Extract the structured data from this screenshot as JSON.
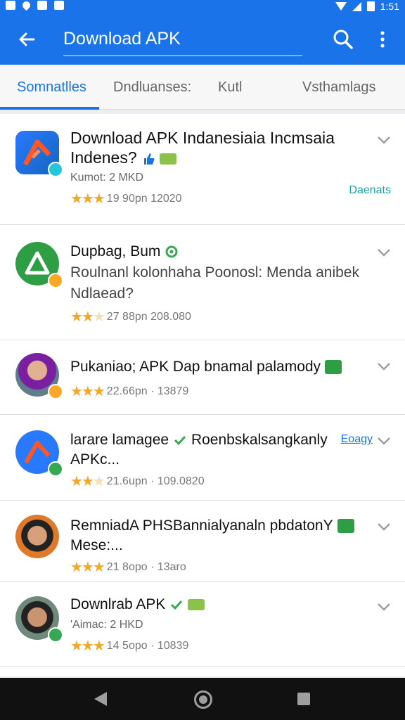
{
  "status_bar": {
    "time": "1:51"
  },
  "app_bar": {
    "title": "Download APK",
    "back_icon": "arrow-back-icon",
    "search_icon": "search-icon",
    "menu_icon": "more-vert-icon"
  },
  "tabs": [
    {
      "label": "Somnatlles",
      "active": true
    },
    {
      "label": "Dndluanses:",
      "active": false
    },
    {
      "label": "Kutl",
      "active": false
    },
    {
      "label": "Vsthamlags",
      "active": false
    }
  ],
  "colors": {
    "accent": "#1a73e8",
    "star": "#f5a623",
    "green": "#34a853"
  },
  "apps": [
    {
      "title_line1": "Download APK Indanesiaia Incmsaia",
      "title_line2": "Indenes?",
      "subtitle": "Kumot: 2 MKD",
      "stars": 3,
      "rating_text": "19 90pn 12020",
      "side_text": "Daenats"
    },
    {
      "title_line1": "Dupbag, Bum",
      "title_line2": "Roulnanl kolonhaha Poonosl: Menda anibek",
      "title_line3": "Ndlaead?",
      "stars": 2.5,
      "rating_text": "27 88pn  208.080"
    },
    {
      "title_line1": "Pukaniao; APK Dap bnamal palamody",
      "stars": 3,
      "rating_text": "22.66pn · 13879"
    },
    {
      "title_line1": "larare lamagee",
      "title_line1b": "Roenbskalsangkanly",
      "link_text": "Eoagy",
      "title_line2": "APKc...",
      "stars": 2.5,
      "rating_text": "21.6upn · 109.0820"
    },
    {
      "title_line1": "RemniadA PHSBannialyanaln pbdatonY",
      "title_line2": "Mese:...",
      "stars": 3,
      "rating_text": "21 8opo · 13aro"
    },
    {
      "title_line1": "Downlrab APK",
      "subtitle": "'Aimac: 2 HKD",
      "stars": 3,
      "rating_text": "14 5opo · 10839"
    }
  ]
}
